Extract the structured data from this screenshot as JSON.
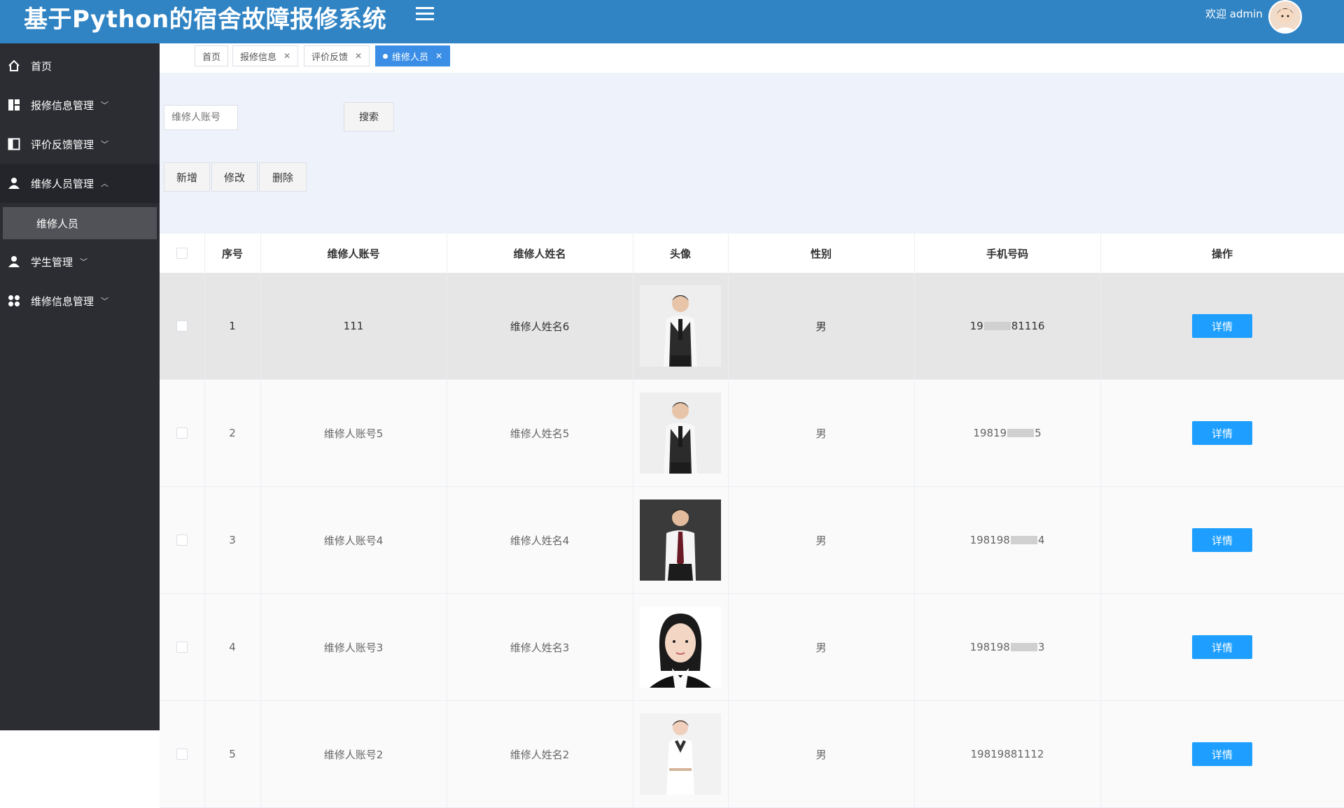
{
  "header": {
    "title": "基于Python的宿舍故障报修系统",
    "welcome": "欢迎 admin"
  },
  "sidebar": {
    "items": [
      {
        "label": "首页",
        "icon": "home-icon"
      },
      {
        "label": "报修信息管理",
        "icon": "grid-icon"
      },
      {
        "label": "评价反馈管理",
        "icon": "panel-icon"
      },
      {
        "label": "维修人员管理",
        "icon": "user-icon"
      },
      {
        "label": "学生管理",
        "icon": "user-icon"
      },
      {
        "label": "维修信息管理",
        "icon": "apps-icon"
      }
    ],
    "sub_item": "维修人员"
  },
  "tabs": [
    {
      "label": "首页",
      "closable": false
    },
    {
      "label": "报修信息",
      "closable": true
    },
    {
      "label": "评价反馈",
      "closable": true
    },
    {
      "label": "维修人员",
      "closable": true,
      "active": true
    }
  ],
  "search": {
    "placeholder": "维修人账号",
    "button": "搜索"
  },
  "actions": {
    "add": "新增",
    "edit": "修改",
    "delete": "删除"
  },
  "table": {
    "columns": [
      "序号",
      "维修人账号",
      "维修人姓名",
      "头像",
      "性别",
      "手机号码",
      "操作"
    ],
    "rows": [
      {
        "index": "1",
        "account": "111",
        "name": "维修人姓名6",
        "gender": "男",
        "phone_pre": "19",
        "phone_post": "81116",
        "action": "详情",
        "photo": "man-vest"
      },
      {
        "index": "2",
        "account": "维修人账号5",
        "name": "维修人姓名5",
        "gender": "男",
        "phone_pre": "19819",
        "phone_post": "5",
        "action": "详情",
        "photo": "man-vest"
      },
      {
        "index": "3",
        "account": "维修人账号4",
        "name": "维修人姓名4",
        "gender": "男",
        "phone_pre": "198198",
        "phone_post": "4",
        "action": "详情",
        "photo": "man-suit"
      },
      {
        "index": "4",
        "account": "维修人账号3",
        "name": "维修人姓名3",
        "gender": "男",
        "phone_pre": "198198",
        "phone_post": "3",
        "action": "详情",
        "photo": "woman-portrait"
      },
      {
        "index": "5",
        "account": "维修人账号2",
        "name": "维修人姓名2",
        "gender": "男",
        "phone_pre": "19819881112",
        "phone_post": "",
        "action": "详情",
        "photo": "woman-uniform"
      }
    ]
  },
  "colors": {
    "header_bg": "#3184c4",
    "sidebar_bg": "#2b2d32",
    "filter_bg": "#eef2fa",
    "detail_button": "#1e9fff",
    "active_tab": "#3a8ee6"
  }
}
